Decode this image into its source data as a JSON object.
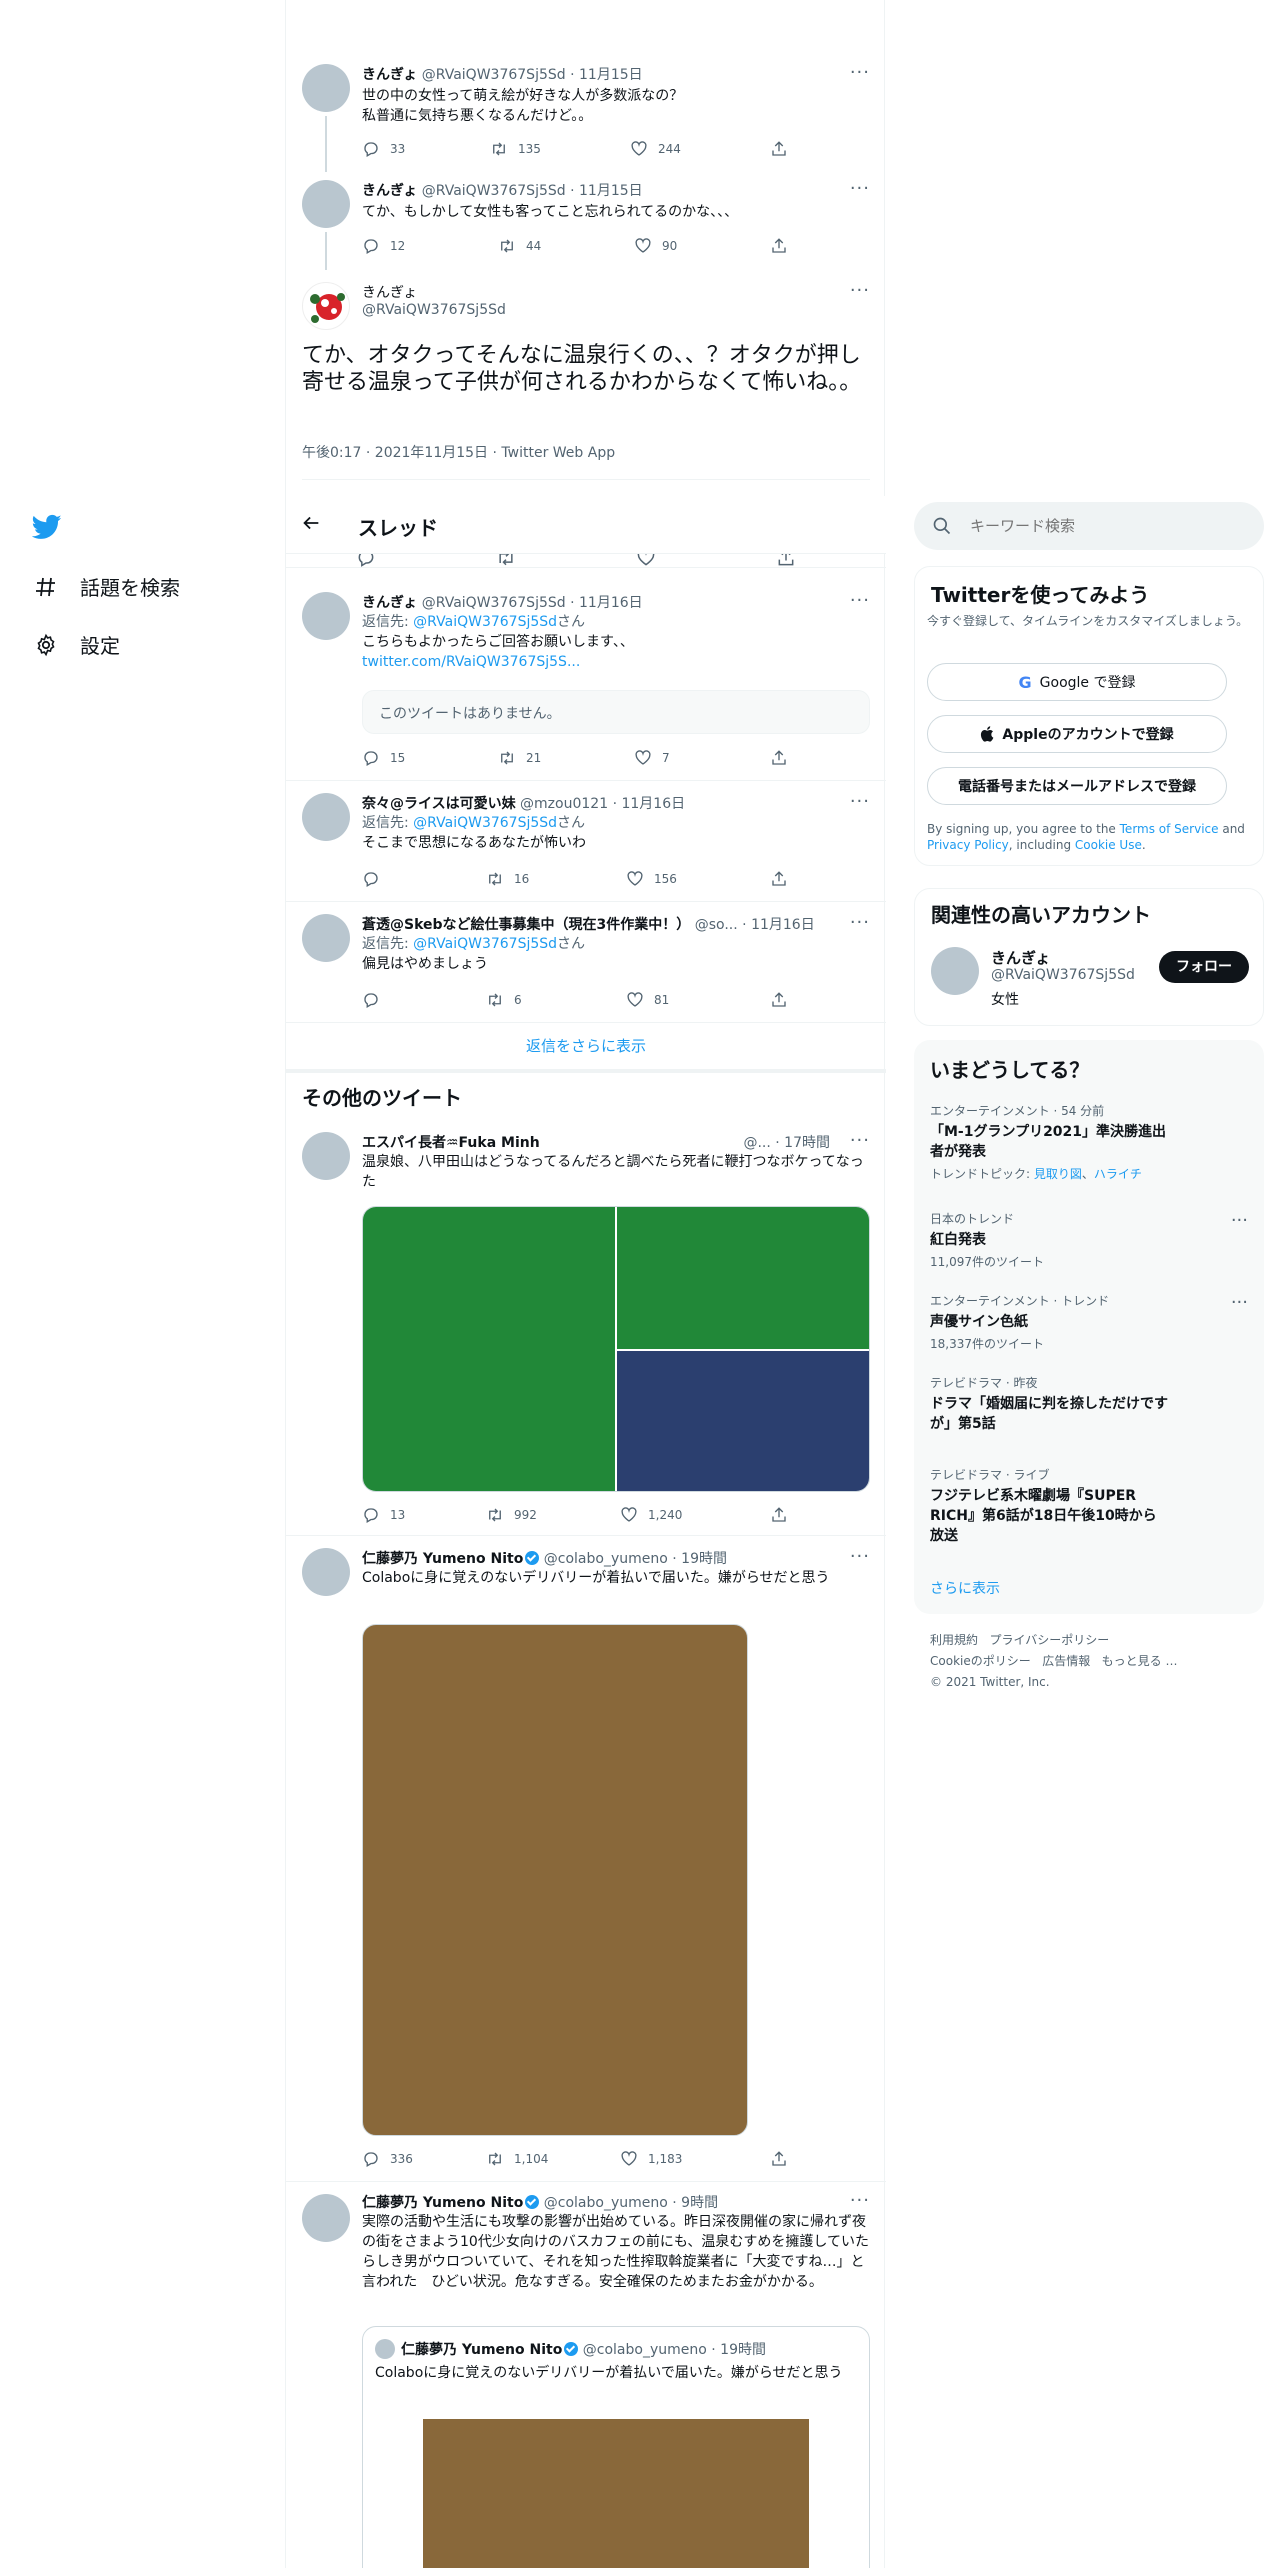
{
  "nav": {
    "explore": "話題を検索",
    "settings": "設定"
  },
  "header": {
    "title": "スレッド"
  },
  "search": {
    "placeholder": "キーワード検索"
  },
  "thread": [
    {
      "name": "きんぎょ",
      "handle": "@RVaiQW3767Sj5Sd",
      "time": "11月15日",
      "text1": "世の中の女性って萌え絵が好きな人が多数派なの？",
      "text2": "私普通に気持ち悪くなるんだけど。。",
      "replies": "33",
      "retweets": "135",
      "likes": "244"
    },
    {
      "name": "きんぎょ",
      "handle": "@RVaiQW3767Sj5Sd",
      "time": "11月15日",
      "text1": "てか、もしかして女性も客ってこと忘れられてるのかな、、、",
      "replies": "12",
      "retweets": "44",
      "likes": "90"
    }
  ],
  "main_tweet": {
    "name": "きんぎょ",
    "handle": "@RVaiQW3767Sj5Sd",
    "text": "てか、オタクってそんなに温泉行くの、、？オタクが押し寄せる温泉って子供が何されるかわからなくて怖いね。。",
    "meta": "午後0:17 · 2021年11月15日 · Twitter Web App"
  },
  "replies": [
    {
      "name": "きんぎょ",
      "handle": "@RVaiQW3767Sj5Sd",
      "time": "11月16日",
      "reply_prefix": "返信先: ",
      "reply_to": "@RVaiQW3767Sj5Sd",
      "reply_suffix": "さん",
      "text": "こちらもよかったらご回答お願いします、、",
      "link": "twitter.com/RVaiQW3767Sj5S...",
      "unavailable": "このツイートはありません。",
      "replies": "15",
      "retweets": "21",
      "likes": "7"
    },
    {
      "name": "奈々@ライスは可愛い妹",
      "handle": "@mzou0121",
      "time": "11月16日",
      "reply_prefix": "返信先: ",
      "reply_to": "@RVaiQW3767Sj5Sd",
      "reply_suffix": "さん",
      "text": "そこまで思想になるあなたが怖いわ",
      "replies": "",
      "retweets": "16",
      "likes": "156"
    },
    {
      "name": "蒼透@Skebなど絵仕事募集中（現在3件作業中！）",
      "handle": "@so...",
      "time": "11月16日",
      "reply_prefix": "返信先: ",
      "reply_to": "@RVaiQW3767Sj5Sd",
      "reply_suffix": "さん",
      "text": "偏見はやめましょう",
      "replies": "",
      "retweets": "6",
      "likes": "81"
    }
  ],
  "show_more_replies": "返信をさらに表示",
  "other_header": "その他のツイート",
  "others": [
    {
      "name": "エスパイ長者♒Fuka Minh",
      "handle": "@...",
      "time": "17時間",
      "text": "温泉娘、八甲田山はどうなってるんだろと調べたら死者に鞭打つなボケってなった",
      "replies": "13",
      "retweets": "992",
      "likes": "1,240"
    },
    {
      "name": "仁藤夢乃 Yumeno Nito",
      "handle": "@colabo_yumeno",
      "time": "19時間",
      "text": "Colaboに身に覚えのないデリバリーが着払いで届いた。嫌がらせだと思う",
      "replies": "336",
      "retweets": "1,104",
      "likes": "1,183"
    },
    {
      "name": "仁藤夢乃 Yumeno Nito",
      "handle": "@colabo_yumeno",
      "time": "9時間",
      "text": "実際の活動や生活にも攻撃の影響が出始めている。昨日深夜開催の家に帰れず夜の街をさまよう10代少女向けのバスカフェの前にも、温泉むすめを擁護していたらしき男がウロついていて、それを知った性搾取斡旋業者に「大変ですね…」と言われた　ひどい状況。危なすぎる。安全確保のためまたお金がかかる。"
    }
  ],
  "quote": {
    "name": "仁藤夢乃 Yumeno Nito",
    "handle": "@colabo_yumeno",
    "time": "19時間",
    "text": "Colaboに身に覚えのないデリバリーが着払いで届いた。嫌がらせだと思う"
  },
  "signup": {
    "title": "Twitterを使ってみよう",
    "desc": "今すぐ登録して、タイムラインをカスタマイズしましょう。",
    "google": "Google で登録",
    "apple": "Appleのアカウントで登録",
    "phone": "電話番号またはメールアドレスで登録",
    "terms1": "By signing up, you agree to the ",
    "terms_link": "Terms of Service",
    "terms2": " and ",
    "privacy_link": "Privacy Policy",
    "terms3": ", including ",
    "cookie_link": "Cookie Use",
    "terms4": "."
  },
  "related": {
    "title": "関連性の高いアカウント",
    "name": "きんぎょ",
    "handle": "@RVaiQW3767Sj5Sd",
    "bio": "女性",
    "follow": "フォロー"
  },
  "trends": {
    "title": "いまどうしてる？",
    "items": [
      {
        "cat": "エンターテインメント · 54 分前",
        "title": "「M-1グランプリ2021」準決勝進出者が発表",
        "topic_prefix": "トレンドトピック: ",
        "topic1": "見取り図",
        "topic_sep": "、",
        "topic2": "ハライチ"
      },
      {
        "cat": "日本のトレンド",
        "title": "紅白発表",
        "count": "11,097件のツイート"
      },
      {
        "cat": "エンターテインメント · トレンド",
        "title": "声優サイン色紙",
        "count": "18,337件のツイート"
      },
      {
        "cat": "テレビドラマ · 昨夜",
        "title": "ドラマ「婚姻届に判を捺しただけですが」第5話"
      },
      {
        "cat": "テレビドラマ · ライブ",
        "title": "フジテレビ系木曜劇場『SUPER RICH』第6話が18日午後10時から放送"
      }
    ],
    "more": "さらに表示"
  },
  "footer": {
    "l1a": "利用規約",
    "l1b": "プライバシーポリシー",
    "l2a": "Cookieのポリシー",
    "l2b": "広告情報",
    "l2c": "もっと見る …",
    "copy": "© 2021 Twitter, Inc."
  },
  "colors": {
    "accent": "#1d9bf0",
    "img_green": "#218838",
    "img_navy": "#2b3f6f",
    "img_brown": "#89683a"
  }
}
